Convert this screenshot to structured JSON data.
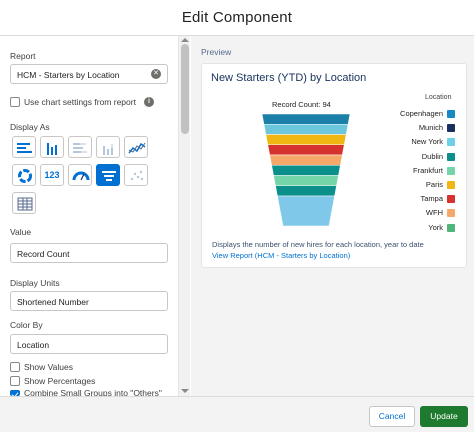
{
  "header": {
    "title": "Edit Component"
  },
  "left": {
    "report_label": "Report",
    "report_value": "HCM - Starters by Location",
    "use_chart_settings_label": "Use chart settings from report",
    "display_as_label": "Display As",
    "display_as_options": [
      "horizontal-bar",
      "vertical-bar",
      "stacked-horizontal",
      "stacked-vertical",
      "line",
      "donut",
      "metric",
      "gauge",
      "funnel",
      "scatter",
      "table"
    ],
    "display_as_selected": "funnel",
    "metric_tile_text": "123",
    "value_label": "Value",
    "value_value": "Record Count",
    "display_units_label": "Display Units",
    "display_units_value": "Shortened Number",
    "color_by_label": "Color By",
    "color_by_value": "Location",
    "show_values_label": "Show Values",
    "show_values_checked": false,
    "show_percentages_label": "Show Percentages",
    "show_percentages_checked": false,
    "combine_label": "Combine Small Groups into \"Others\"",
    "combine_checked": true
  },
  "preview": {
    "label": "Preview",
    "card_title": "New Starters (YTD) by Location",
    "record_count": "Record Count: 94",
    "description": "Displays the number of new hires for each location, year to date",
    "view_report_link": "View Report (HCM - Starters by Location)"
  },
  "chart_data": {
    "type": "funnel",
    "title": "New Starters (YTD) by Location",
    "legend_title": "Location",
    "legend_position": "right",
    "categories": [
      "Copenhagen",
      "Munich",
      "New York",
      "Dublin",
      "Frankfurt",
      "Paris",
      "Tampa",
      "WFH",
      "York"
    ],
    "colors": [
      "#1589c4",
      "#16325c",
      "#6fd0e8",
      "#0a8f8a",
      "#74d6a8",
      "#f0b712",
      "#d6332e",
      "#f6a86a",
      "#4eb67a"
    ],
    "funnel_band_colors": [
      "#1b7fa8",
      "#6cc7dd",
      "#f0b712",
      "#d6332e",
      "#f6a86a",
      "#0a8f8a",
      "#74d6a8",
      "#0a8f8a",
      "#80c8ea"
    ]
  },
  "footer": {
    "cancel_label": "Cancel",
    "update_label": "Update"
  }
}
